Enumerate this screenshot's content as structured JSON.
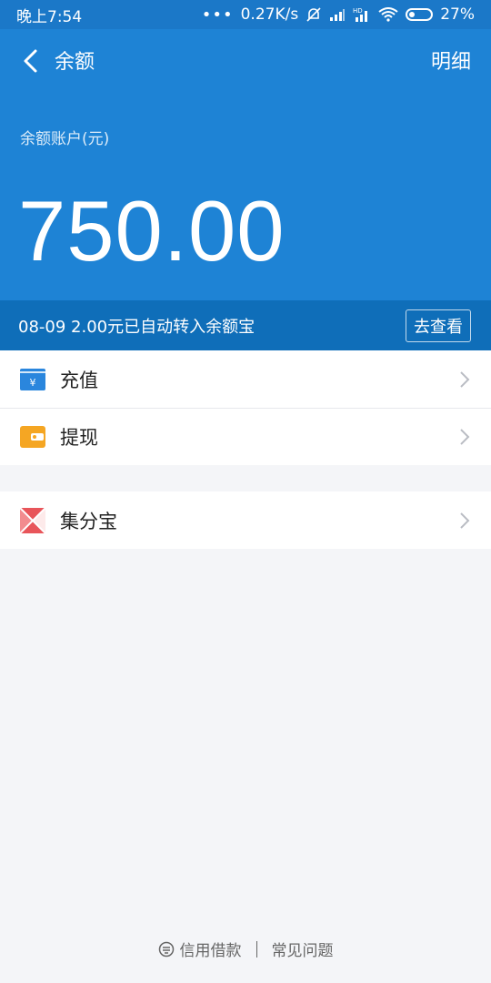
{
  "status_bar": {
    "time": "晚上7:54",
    "network_speed": "0.27K/s",
    "battery_percent": "27%",
    "hd_label": "HD"
  },
  "header": {
    "title": "余额",
    "detail_label": "明细",
    "account_label": "余额账户(元)",
    "amount": "750.00"
  },
  "notice": {
    "text": "08-09 2.00元已自动转入余额宝",
    "button": "去查看"
  },
  "menu": {
    "items": [
      {
        "label": "充值",
        "icon": "recharge-icon"
      },
      {
        "label": "提现",
        "icon": "wallet-icon"
      }
    ],
    "extra": [
      {
        "label": "集分宝",
        "icon": "jifenbao-icon"
      }
    ]
  },
  "footer": {
    "credit_loan": "信用借款",
    "faq": "常见问题"
  },
  "colors": {
    "header_bg": "#1e83d5",
    "notice_bg": "#0f6eb9",
    "recharge": "#2a86dd",
    "wallet": "#f5a623",
    "jifenbao": "#e8555a"
  }
}
